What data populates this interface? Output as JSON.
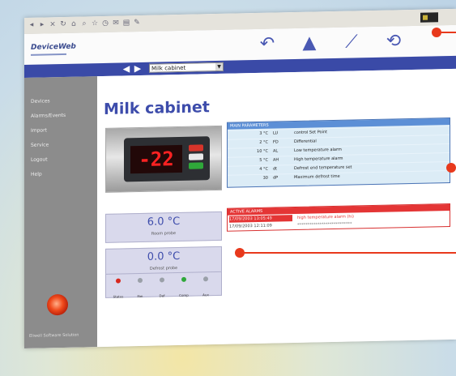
{
  "app": {
    "logo": "DeviceWeb",
    "page_title": "Milk cabinet"
  },
  "nav": {
    "prev_arrow": "◀",
    "next_arrow": "▶",
    "device_selector": "Milk cabinet"
  },
  "sidebar": {
    "items": [
      {
        "label": "Devices"
      },
      {
        "label": "Alarms/Events"
      },
      {
        "label": "Import"
      },
      {
        "label": "Service"
      },
      {
        "label": "Logout"
      },
      {
        "label": "Help"
      }
    ],
    "footer": "Eliwell Software Solution"
  },
  "controller_display": "-22",
  "room_probe": {
    "value": "6.0 °C",
    "label": "Room probe"
  },
  "defrost_probe": {
    "value": "0.0 °C",
    "label": "Defrost probe"
  },
  "status_indicators": [
    {
      "label": "Status",
      "color": "#d8281e"
    },
    {
      "label": "Fan",
      "color": "#9aa0a8"
    },
    {
      "label": "Def",
      "color": "#9aa0a8"
    },
    {
      "label": "Comp",
      "color": "#2fa83a"
    },
    {
      "label": "Aux",
      "color": "#9aa0a8"
    }
  ],
  "main_parameters": {
    "title": "MAIN PARAMETERS",
    "rows": [
      {
        "value": "3 °C",
        "code": "LU",
        "description": "control Set Point"
      },
      {
        "value": "2 °C",
        "code": "FD",
        "description": "Differential"
      },
      {
        "value": "10 °C",
        "code": "AL",
        "description": "Low temperature alarm"
      },
      {
        "value": "5 °C",
        "code": "AH",
        "description": "High temperature alarm"
      },
      {
        "value": "4 °C",
        "code": "dt",
        "description": "Defrost end temperature set"
      },
      {
        "value": "30",
        "code": "dP",
        "description": "Maximum defrost time"
      }
    ]
  },
  "active_alarms": {
    "title": "ACTIVE ALARMS",
    "rows": [
      {
        "time": "17/09/2003 13:05:49",
        "message": "high temperature alarm (hi)"
      },
      {
        "time": "17/09/2003 12:11:09",
        "message": "***************************"
      }
    ]
  },
  "colors": {
    "accent": "#3d4cab",
    "nav_bar": "#3a4aa7",
    "sidebar": "#8c8c8c",
    "params_header": "#5c8fd6",
    "alarm_header": "#e43535",
    "callout": "#e8391c"
  },
  "icons": {
    "toolbar": [
      "back-icon",
      "forward-icon",
      "stop-icon",
      "refresh-icon",
      "home-icon",
      "search-icon",
      "favorites-icon",
      "history-icon",
      "mail-icon",
      "print-icon",
      "edit-icon"
    ],
    "header": [
      "undo-icon",
      "bell-icon",
      "graph-icon",
      "restore-icon"
    ]
  }
}
